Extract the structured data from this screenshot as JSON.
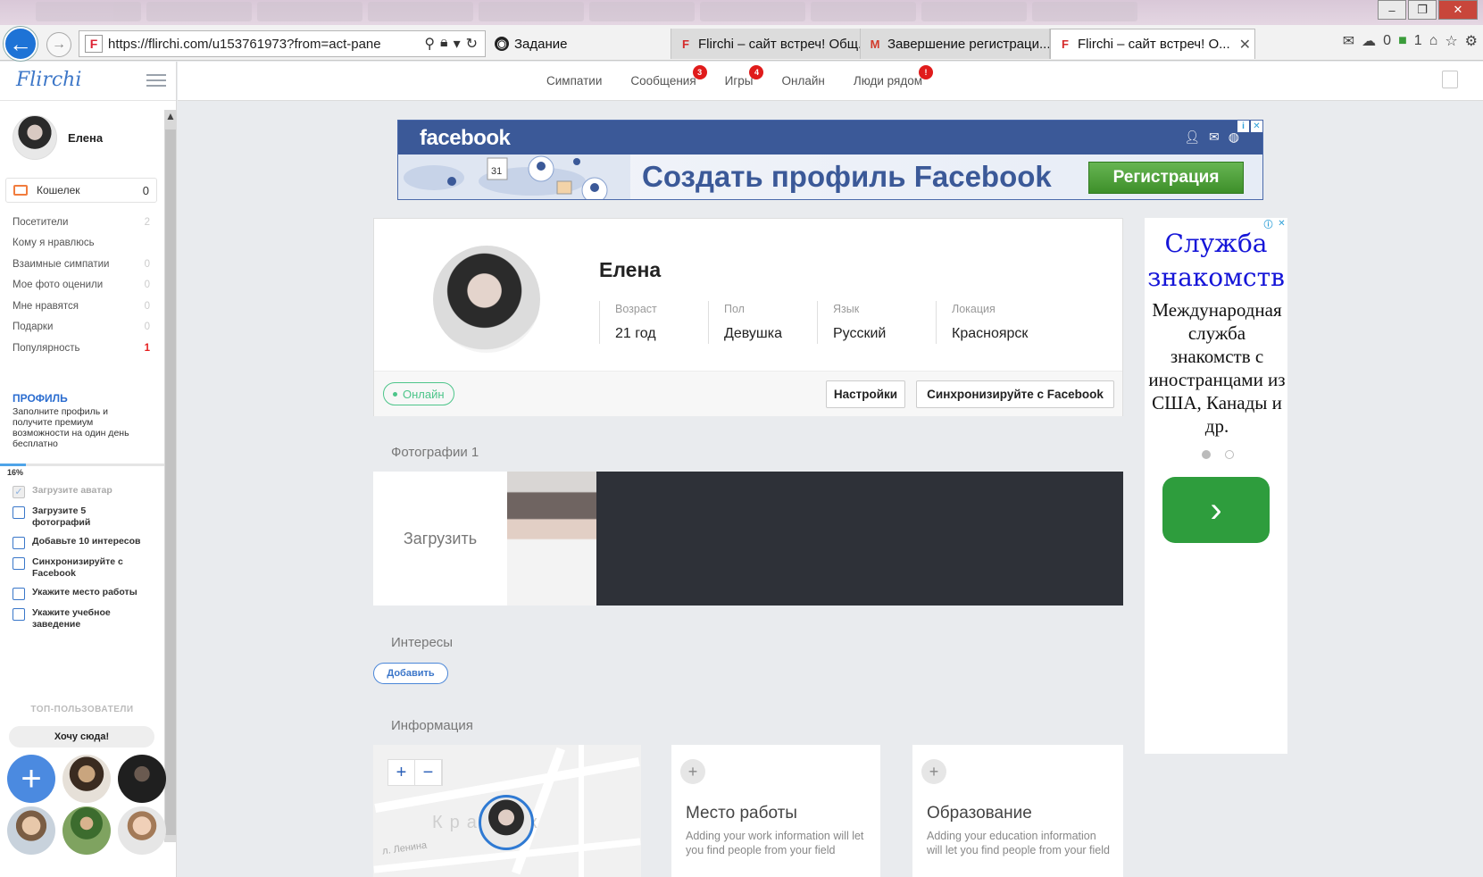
{
  "browser": {
    "url": "https://flirchi.com/u153761973?from=act-pane",
    "tabs": [
      {
        "label": "Задание",
        "icon": "camera-icon"
      },
      {
        "label": "Flirchi – сайт встреч! Общ...",
        "icon": "flirchi-icon"
      },
      {
        "label": "Завершение регистраци...",
        "icon": "gmail-icon"
      },
      {
        "label": "Flirchi – сайт встреч! О...",
        "icon": "flirchi-icon"
      }
    ],
    "mail_count": "0",
    "ext_count": "1"
  },
  "sidebar": {
    "logo": "Flirchi",
    "user_name": "Елена",
    "wallet": {
      "label": "Кошелек",
      "count": "0"
    },
    "stats": [
      {
        "label": "Посетители",
        "value": "2"
      },
      {
        "label": "Кому я нравлюсь",
        "value": ""
      },
      {
        "label": "Взаимные симпатии",
        "value": "0"
      },
      {
        "label": "Мое фото оценили",
        "value": "0"
      },
      {
        "label": "Мне нравятся",
        "value": "0"
      },
      {
        "label": "Подарки",
        "value": "0"
      },
      {
        "label": "Популярность",
        "value": "1"
      }
    ],
    "profile_title": "ПРОФИЛЬ",
    "profile_desc": "Заполните профиль и получите премиум возможности на один день бесплатно",
    "progress_label": "16%",
    "progress_fraction": 0.16,
    "tasks": [
      {
        "label": "Загрузите аватар",
        "done": true
      },
      {
        "label": "Загрузите 5 фотографий",
        "done": false
      },
      {
        "label": "Добавьте 10 интересов",
        "done": false
      },
      {
        "label": "Синхронизируйте с Facebook",
        "done": false
      },
      {
        "label": "Укажите место работы",
        "done": false
      },
      {
        "label": "Укажите учебное заведение",
        "done": false
      }
    ],
    "top_users_title": "ТОП-ПОЛЬЗОВАТЕЛИ",
    "want_here": "Хочу сюда!"
  },
  "nav": {
    "items": [
      {
        "label": "Симпатии",
        "badge": ""
      },
      {
        "label": "Сообщения",
        "badge": "3"
      },
      {
        "label": "Игры",
        "badge": "4"
      },
      {
        "label": "Онлайн",
        "badge": ""
      },
      {
        "label": "Люди рядом",
        "badge": "!"
      }
    ]
  },
  "fb_ad": {
    "logo": "facebook",
    "headline": "Создать профиль Facebook",
    "button": "Регистрация",
    "calendar_day": "31"
  },
  "profile": {
    "name": "Елена",
    "fields": [
      {
        "label": "Возраст",
        "value": "21 год"
      },
      {
        "label": "Пол",
        "value": "Девушка"
      },
      {
        "label": "Язык",
        "value": "Русский"
      },
      {
        "label": "Локация",
        "value": "Красноярск"
      }
    ],
    "status": "Онлайн",
    "settings_button": "Настройки",
    "sync_button": "Синхронизируйте с Facebook"
  },
  "photos": {
    "title": "Фотографии 1",
    "upload": "Загрузить"
  },
  "interests": {
    "title": "Интересы",
    "add": "Добавить"
  },
  "info": {
    "title": "Информация",
    "map_city": "Кра      рск",
    "map_street": "л. Ленина",
    "work": {
      "title": "Место работы",
      "text": "Adding your work information will let you find people from your field"
    },
    "education": {
      "title": "Образование",
      "text": "Adding your education information will let you find people from your field"
    }
  },
  "side_ad": {
    "title": "Служба знакомств",
    "text": "Международная служба знакомств с иностранцами из США, Канады и др."
  },
  "colors": {
    "accent": "#3b76c9",
    "online": "#4dc58a",
    "badge": "#e01b1b",
    "facebook": "#3b5998"
  }
}
